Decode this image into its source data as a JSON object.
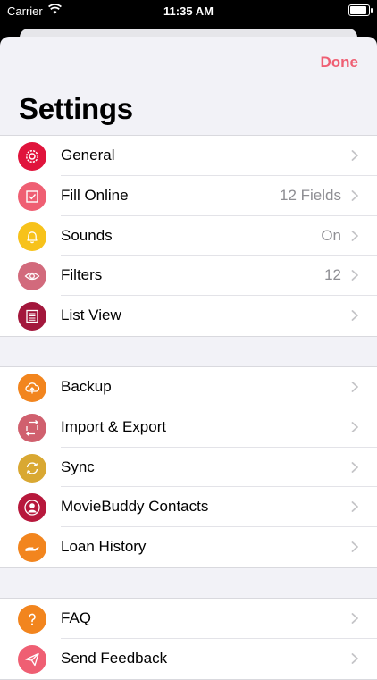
{
  "status_bar": {
    "carrier": "Carrier",
    "time": "11:35 AM"
  },
  "header": {
    "title": "Settings",
    "done_label": "Done"
  },
  "groups": [
    {
      "items": [
        {
          "label": "General",
          "value": "",
          "icon": "gear-icon",
          "color": "#e0143c"
        },
        {
          "label": "Fill Online",
          "value": "12 Fields",
          "icon": "checkbox-icon",
          "color": "#ef5f73"
        },
        {
          "label": "Sounds",
          "value": "On",
          "icon": "bell-icon",
          "color": "#f7c21b"
        },
        {
          "label": "Filters",
          "value": "12",
          "icon": "eye-icon",
          "color": "#d26a7c"
        },
        {
          "label": "List View",
          "value": "",
          "icon": "list-icon",
          "color": "#a3173c"
        }
      ]
    },
    {
      "items": [
        {
          "label": "Backup",
          "value": "",
          "icon": "cloud-upload-icon",
          "color": "#f2851e"
        },
        {
          "label": "Import & Export",
          "value": "",
          "icon": "arrows-icon",
          "color": "#d0606e"
        },
        {
          "label": "Sync",
          "value": "",
          "icon": "sync-icon",
          "color": "#d9a832"
        },
        {
          "label": "MovieBuddy Contacts",
          "value": "",
          "icon": "person-icon",
          "color": "#b7183c"
        },
        {
          "label": "Loan History",
          "value": "",
          "icon": "hand-icon",
          "color": "#f2851e"
        }
      ]
    },
    {
      "items": [
        {
          "label": "FAQ",
          "value": "",
          "icon": "question-icon",
          "color": "#f2851e"
        },
        {
          "label": "Send Feedback",
          "value": "",
          "icon": "paper-plane-icon",
          "color": "#ef5f73"
        }
      ]
    }
  ]
}
